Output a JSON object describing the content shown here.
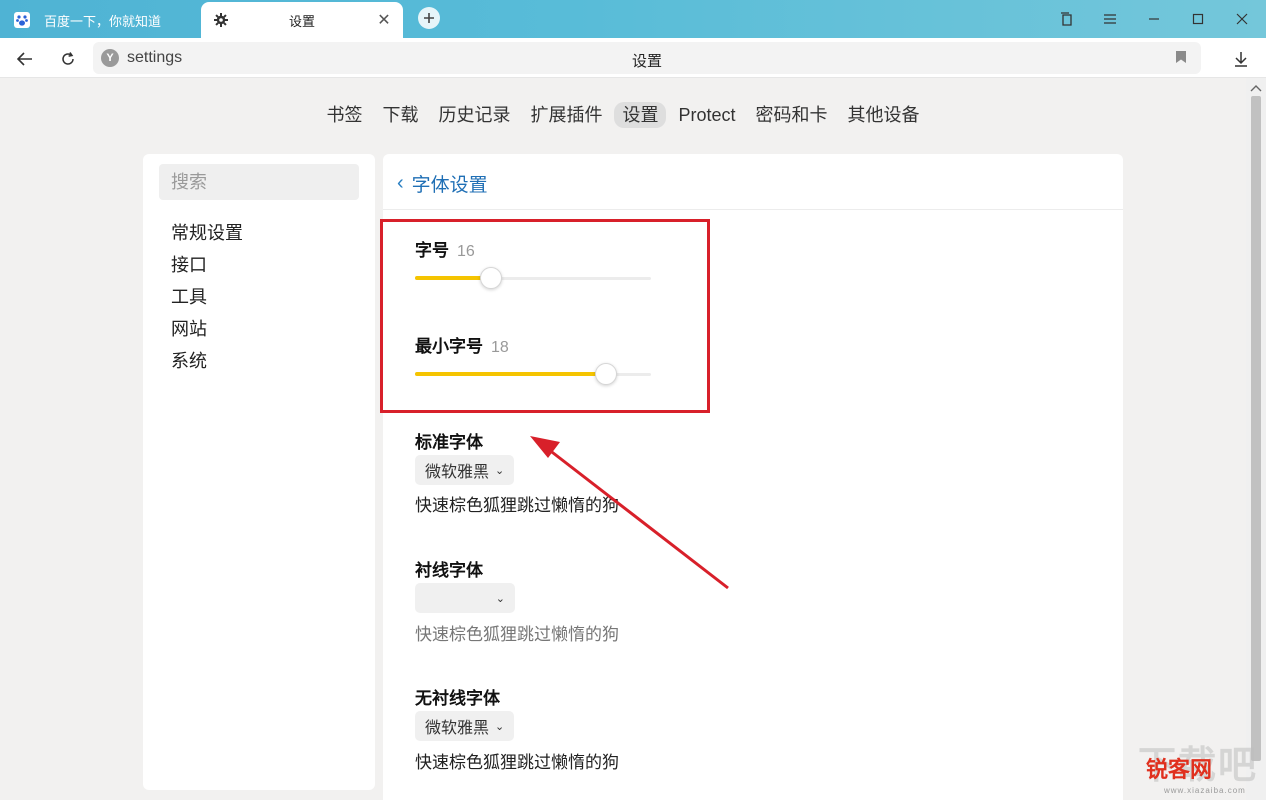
{
  "tabs": [
    {
      "title": "百度一下，你就知道",
      "icon": "baidu-paw-icon"
    },
    {
      "title": "设置",
      "icon": "gear-icon",
      "active": true
    }
  ],
  "address_bar": {
    "url": "settings",
    "page_title": "设置"
  },
  "settings_nav": [
    "书签",
    "下载",
    "历史记录",
    "扩展插件",
    "设置",
    "Protect",
    "密码和卡",
    "其他设备"
  ],
  "settings_nav_active": "设置",
  "sidebar": {
    "search_placeholder": "搜索",
    "items": [
      "常规设置",
      "接口",
      "工具",
      "网站",
      "系统"
    ]
  },
  "main": {
    "back_label": "字体设置",
    "font_size": {
      "label": "字号",
      "value": "16",
      "level": 0.32
    },
    "min_font_size": {
      "label": "最小字号",
      "value": "18",
      "level": 0.81
    },
    "standard_font": {
      "label": "标准字体",
      "selected": "微软雅黑",
      "preview": "快速棕色狐狸跳过懒惰的狗"
    },
    "serif_font": {
      "label": "衬线字体",
      "selected": "",
      "preview": "快速棕色狐狸跳过懒惰的狗"
    },
    "sans_font": {
      "label": "无衬线字体",
      "selected": "微软雅黑",
      "preview": "快速棕色狐狸跳过懒惰的狗"
    }
  },
  "colors": {
    "accent": "#f5c400",
    "link": "#1f6fb5",
    "annotation": "#d8202a"
  },
  "watermark": {
    "text": "下载吧",
    "logo": "锐客网",
    "url": "www.xiazaiba.com"
  }
}
